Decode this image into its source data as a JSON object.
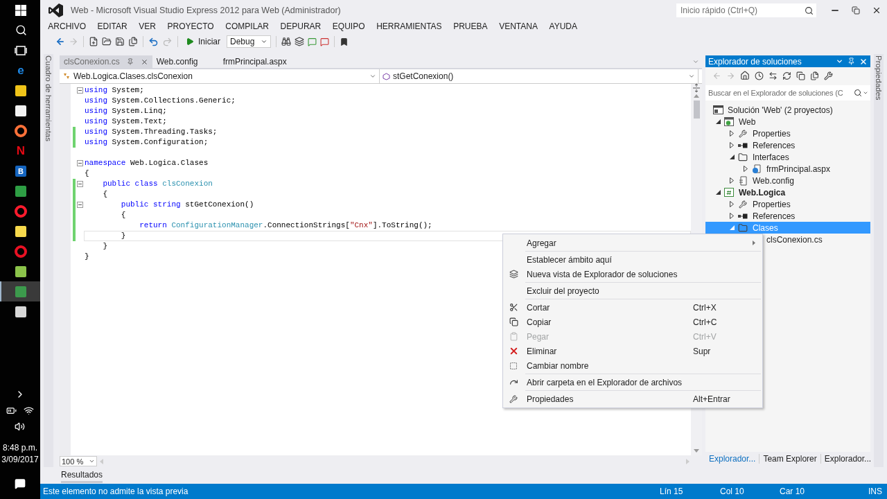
{
  "taskbar": {
    "apps": [
      {
        "kind": "start",
        "selected": false
      },
      {
        "kind": "search",
        "selected": false
      },
      {
        "kind": "taskview",
        "selected": false
      },
      {
        "kind": "letter",
        "glyph": "e",
        "color": "#1e88e5",
        "selected": false
      },
      {
        "kind": "tile",
        "color": "#f0c419",
        "selected": false
      },
      {
        "kind": "tile",
        "color": "#f2f2f2",
        "selected": false
      },
      {
        "kind": "ring",
        "color": "#ff7139",
        "selected": false
      },
      {
        "kind": "letter",
        "glyph": "N",
        "color": "#e50914",
        "selected": false
      },
      {
        "kind": "tile",
        "glyph": "B",
        "color": "#1565c0",
        "selected": false
      },
      {
        "kind": "tile",
        "color": "#2e9e44",
        "selected": false
      },
      {
        "kind": "ring",
        "color": "#ff1b2d",
        "selected": false
      },
      {
        "kind": "tile",
        "color": "#f7d94c",
        "selected": false
      },
      {
        "kind": "ring",
        "color": "#e81123",
        "selected": false
      },
      {
        "kind": "tile",
        "color": "#8bc34a",
        "selected": false
      },
      {
        "kind": "tile",
        "color": "#3c9a4c",
        "selected": true
      },
      {
        "kind": "tile",
        "color": "#d8d8d8",
        "selected": false
      }
    ],
    "time": "8:48 p.m.",
    "date": "3/09/2017"
  },
  "window": {
    "title": "Web - Microsoft Visual Studio Express 2012 para Web (Administrador)",
    "quick_launch": {
      "placeholder": "Inicio rápido (Ctrl+Q)"
    }
  },
  "menu": [
    "ARCHIVO",
    "EDITAR",
    "VER",
    "PROYECTO",
    "COMPILAR",
    "DEPURAR",
    "EQUIPO",
    "HERRAMIENTAS",
    "PRUEBA",
    "VENTANA",
    "AYUDA"
  ],
  "toolbar": {
    "start": "Iniciar",
    "configuration": "Debug"
  },
  "side_panels": {
    "left": "Cuadro de herramientas",
    "right": "Propiedades"
  },
  "tabs": [
    {
      "label": "clsConexion.cs",
      "selected": true
    },
    {
      "label": "Web.config",
      "selected": false
    },
    {
      "label": "frmPrincipal.aspx",
      "selected": false
    }
  ],
  "navigation": {
    "type": "Web.Logica.Clases.clsConexion",
    "member": "stGetConexion()"
  },
  "code": {
    "lines": [
      {
        "fold": true,
        "changed": false,
        "current": false,
        "tokens": [
          {
            "kind": "keyword",
            "text": "using"
          },
          {
            "kind": "plain",
            "text": " System;"
          }
        ]
      },
      {
        "fold": false,
        "changed": false,
        "current": false,
        "tokens": [
          {
            "kind": "keyword",
            "text": "using"
          },
          {
            "kind": "plain",
            "text": " System.Collections.Generic;"
          }
        ]
      },
      {
        "fold": false,
        "changed": false,
        "current": false,
        "tokens": [
          {
            "kind": "keyword",
            "text": "using"
          },
          {
            "kind": "plain",
            "text": " System.Linq;"
          }
        ]
      },
      {
        "fold": false,
        "changed": false,
        "current": false,
        "tokens": [
          {
            "kind": "keyword",
            "text": "using"
          },
          {
            "kind": "plain",
            "text": " System.Text;"
          }
        ]
      },
      {
        "fold": false,
        "changed": true,
        "current": false,
        "tokens": [
          {
            "kind": "keyword",
            "text": "using"
          },
          {
            "kind": "plain",
            "text": " System.Threading.Tasks;"
          }
        ]
      },
      {
        "fold": false,
        "changed": true,
        "current": false,
        "tokens": [
          {
            "kind": "keyword",
            "text": "using"
          },
          {
            "kind": "plain",
            "text": " System.Configuration;"
          }
        ]
      },
      {
        "fold": false,
        "changed": false,
        "current": false
      },
      {
        "fold": true,
        "changed": false,
        "current": false,
        "tokens": [
          {
            "kind": "keyword",
            "text": "namespace"
          },
          {
            "kind": "plain",
            "text": " Web.Logica.Clases"
          }
        ]
      },
      {
        "fold": false,
        "changed": false,
        "current": false,
        "tokens": [
          {
            "kind": "plain",
            "text": "{"
          }
        ]
      },
      {
        "fold": true,
        "changed": true,
        "current": false,
        "tokens": [
          {
            "kind": "keyword",
            "text": "    public class "
          },
          {
            "kind": "type",
            "text": "clsConexion"
          }
        ]
      },
      {
        "fold": false,
        "changed": true,
        "current": false,
        "tokens": [
          {
            "kind": "plain",
            "text": "    {"
          }
        ]
      },
      {
        "fold": true,
        "changed": true,
        "current": false,
        "tokens": [
          {
            "kind": "keyword",
            "text": "        public string "
          },
          {
            "kind": "plain",
            "text": "stGetConexion()"
          }
        ]
      },
      {
        "fold": false,
        "changed": true,
        "current": false,
        "tokens": [
          {
            "kind": "plain",
            "text": "        {"
          }
        ]
      },
      {
        "fold": false,
        "changed": true,
        "current": false,
        "tokens": [
          {
            "kind": "keyword",
            "text": "            return "
          },
          {
            "kind": "type",
            "text": "ConfigurationManager"
          },
          {
            "kind": "plain",
            "text": ".ConnectionStrings["
          },
          {
            "kind": "string",
            "text": "\"Cnx\""
          },
          {
            "kind": "plain",
            "text": "].ToString();"
          }
        ]
      },
      {
        "fold": false,
        "changed": true,
        "current": true,
        "tokens": [
          {
            "kind": "plain",
            "text": "        }"
          }
        ]
      },
      {
        "fold": false,
        "changed": false,
        "current": false,
        "tokens": [
          {
            "kind": "plain",
            "text": "    }"
          }
        ]
      },
      {
        "fold": false,
        "changed": false,
        "current": false,
        "tokens": [
          {
            "kind": "plain",
            "text": "}"
          }
        ]
      }
    ]
  },
  "zoom": "100 %",
  "solution_explorer": {
    "title": "Explorador de soluciones",
    "search": {
      "placeholder": "Buscar en el Explorador de soluciones (C"
    },
    "solution": "Solución 'Web'  (2 proyectos)",
    "tree": [
      {
        "label": "Web",
        "kind": "project-web",
        "bold": false,
        "expanded": true,
        "selected": false,
        "children": [
          {
            "label": "Properties",
            "kind": "properties",
            "bold": false,
            "expanded": false,
            "selected": false
          },
          {
            "label": "References",
            "kind": "references",
            "bold": false,
            "expanded": false,
            "selected": false
          },
          {
            "label": "Interfaces",
            "kind": "folder",
            "bold": false,
            "expanded": true,
            "selected": false,
            "children": [
              {
                "label": "frmPrincipal.aspx",
                "kind": "web-form",
                "bold": false,
                "expanded": false,
                "selected": false
              }
            ]
          },
          {
            "label": "Web.config",
            "kind": "config",
            "bold": false,
            "expanded": false,
            "selected": false
          }
        ]
      },
      {
        "label": "Web.Logica",
        "kind": "project-csharp",
        "bold": true,
        "expanded": true,
        "selected": false,
        "children": [
          {
            "label": "Properties",
            "kind": "properties",
            "bold": false,
            "expanded": false,
            "selected": false
          },
          {
            "label": "References",
            "kind": "references",
            "bold": false,
            "expanded": false,
            "selected": false
          },
          {
            "label": "Clases",
            "kind": "folder",
            "bold": false,
            "expanded": true,
            "selected": true,
            "children": [
              {
                "label": "clsConexion.cs",
                "bold": false,
                "selected": false
              }
            ]
          }
        ]
      }
    ],
    "bottom_tabs": [
      {
        "label": "Explorador...",
        "selected": true
      },
      {
        "label": "Team Explorer",
        "selected": false
      },
      {
        "label": "Explorador...",
        "selected": false
      }
    ]
  },
  "context_menu": {
    "groups": [
      [
        {
          "label": "Agregar",
          "submenu": true,
          "disabled": false
        }
      ],
      [
        {
          "label": "Establecer ámbito aquí",
          "submenu": false,
          "disabled": false
        },
        {
          "label": "Nueva vista de Explorador de soluciones",
          "submenu": false,
          "disabled": false
        }
      ],
      [
        {
          "label": "Excluir del proyecto",
          "submenu": false,
          "disabled": false
        }
      ],
      [
        {
          "label": "Cortar",
          "shortcut": "Ctrl+X",
          "submenu": false,
          "disabled": false
        },
        {
          "label": "Copiar",
          "shortcut": "Ctrl+C",
          "submenu": false,
          "disabled": false
        },
        {
          "label": "Pegar",
          "shortcut": "Ctrl+V",
          "submenu": false,
          "disabled": true
        },
        {
          "label": "Eliminar",
          "shortcut": "Supr",
          "submenu": false,
          "disabled": false
        },
        {
          "label": "Cambiar nombre",
          "submenu": false,
          "disabled": false
        }
      ],
      [
        {
          "label": "Abrir carpeta en el Explorador de archivos",
          "submenu": false,
          "disabled": false
        }
      ],
      [
        {
          "label": "Propiedades",
          "shortcut": "Alt+Entrar",
          "submenu": false,
          "disabled": false
        }
      ]
    ]
  },
  "output_tab": "Resultados",
  "status_bar": {
    "message": "Este elemento no admite la vista previa",
    "line": "Lín 15",
    "column": "Col 10",
    "character": "Car 10",
    "mode": "INS"
  }
}
